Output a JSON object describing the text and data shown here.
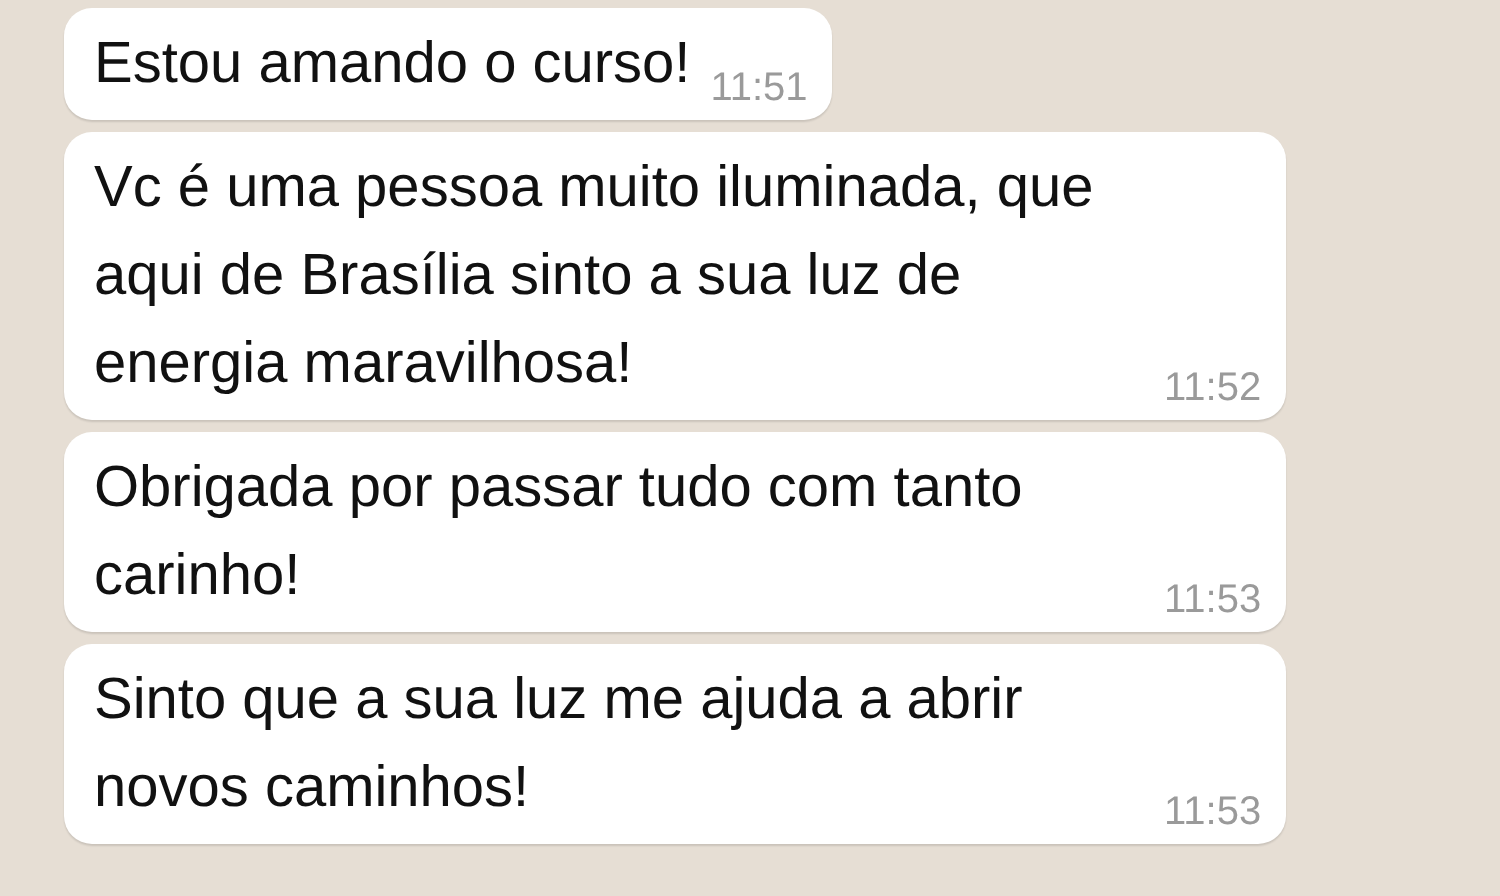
{
  "messages": [
    {
      "text": "Estou amando o curso!",
      "time": "11:51"
    },
    {
      "text": "Vc é uma pessoa muito iluminada, que aqui de Brasília sinto a sua luz de energia maravilhosa!",
      "time": "11:52"
    },
    {
      "text": "Obrigada por passar tudo com tanto carinho!",
      "time": "11:53"
    },
    {
      "text": "Sinto que a sua luz me ajuda a abrir novos caminhos!",
      "time": "11:53"
    }
  ]
}
